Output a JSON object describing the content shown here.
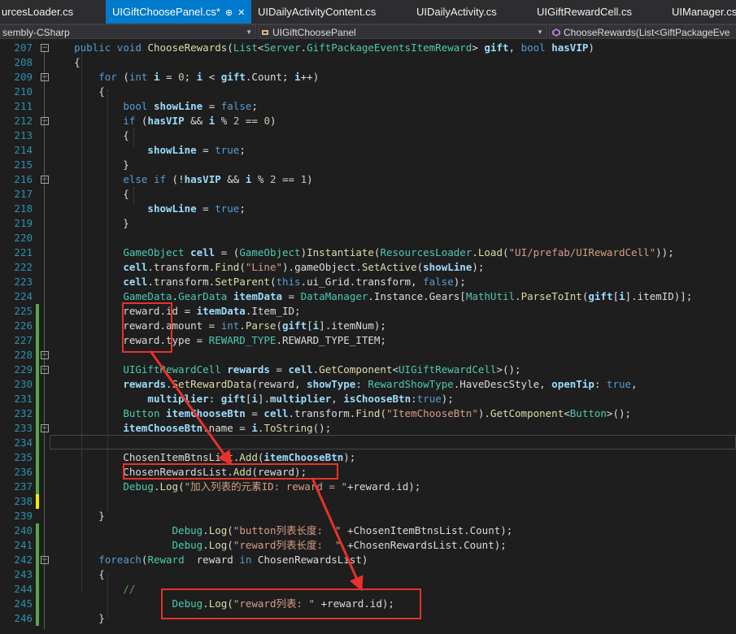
{
  "tabs": [
    {
      "label": "urcesLoader.cs",
      "active": false
    },
    {
      "label": "UIGiftChoosePanel.cs*",
      "active": true
    },
    {
      "label": "UIDailyActivityContent.cs",
      "active": false
    },
    {
      "label": "UIDailyActivity.cs",
      "active": false
    },
    {
      "label": "UIGiftRewardCell.cs",
      "active": false
    },
    {
      "label": "UIManager.cs",
      "active": false
    }
  ],
  "active_tab_pin": "⊕",
  "active_tab_close": "✕",
  "nav": {
    "project": "sembly-CSharp",
    "type": "UIGiftChoosePanel",
    "member": "ChooseRewards(List<GiftPackageEve"
  },
  "colors": {
    "accent": "#007acc",
    "annotation": "#e8312a",
    "saved_change": "#57a64a",
    "unsaved_change": "#efef00"
  },
  "line_numbers": [
    "207",
    "208",
    "209",
    "210",
    "211",
    "212",
    "213",
    "214",
    "215",
    "216",
    "217",
    "218",
    "219",
    "220",
    "221",
    "222",
    "223",
    "224",
    "225",
    "226",
    "227",
    "228",
    "229",
    "230",
    "231",
    "232",
    "233",
    "234",
    "235",
    "236",
    "237",
    "238",
    "239",
    "240",
    "241",
    "242",
    "243",
    "244",
    "245",
    "246"
  ],
  "code_lines": [
    "    public void ChooseRewards(List<Server.GiftPackageEventsItemReward> gift, bool hasVIP)",
    "    {",
    "        for (int i = 0; i < gift.Count; i++)",
    "        {",
    "            bool showLine = false;",
    "            if (hasVIP && i % 2 == 0)",
    "            {",
    "                showLine = true;",
    "            }",
    "            else if (!hasVIP && i % 2 == 1)",
    "            {",
    "                showLine = true;",
    "            }",
    "",
    "            GameObject cell = (GameObject)Instantiate(ResourcesLoader.Load(\"UI/prefab/UIRewardCell\"));",
    "            cell.transform.Find(\"Line\").gameObject.SetActive(showLine);",
    "            cell.transform.SetParent(this.ui_Grid.transform, false);",
    "            GameData.GearData itemData = DataManager.Instance.Gears[MathUtil.ParseToInt(gift[i].itemID)];",
    "            reward.id = itemData.Item_ID;",
    "            reward.amount = int.Parse(gift[i].itemNum);",
    "            reward.type = REWARD_TYPE.REWARD_TYPE_ITEM;",
    "",
    "            UIGiftRewardCell rewards = cell.GetComponent<UIGiftRewardCell>();",
    "            rewards.SetRewardData(reward, showType: RewardShowType.HaveDescStyle, openTip: true,",
    "                multiplier: gift[i].multiplier, isChooseBtn:true);",
    "            Button itemChooseBtn = cell.transform.Find(\"ItemChooseBtn\").GetComponent<Button>();",
    "            itemChooseBtn.name = i.ToString();",
    "",
    "            ChosenItemBtnsList.Add(itemChooseBtn);",
    "            ChosenRewardsList.Add(reward);",
    "            Debug.Log(\"加入列表的元素ID: reward = \"+reward.id);",
    "",
    "        }",
    "                    Debug.Log(\"button列表长度:  \" +ChosenItemBtnsList.Count);",
    "                    Debug.Log(\"reward列表长度:  \" +ChosenRewardsList.Count);",
    "        foreach(Reward  reward in ChosenRewardsList)",
    "        {",
    "            //",
    "                    Debug.Log(\"reward列表: \" +reward.id);",
    "        }"
  ]
}
